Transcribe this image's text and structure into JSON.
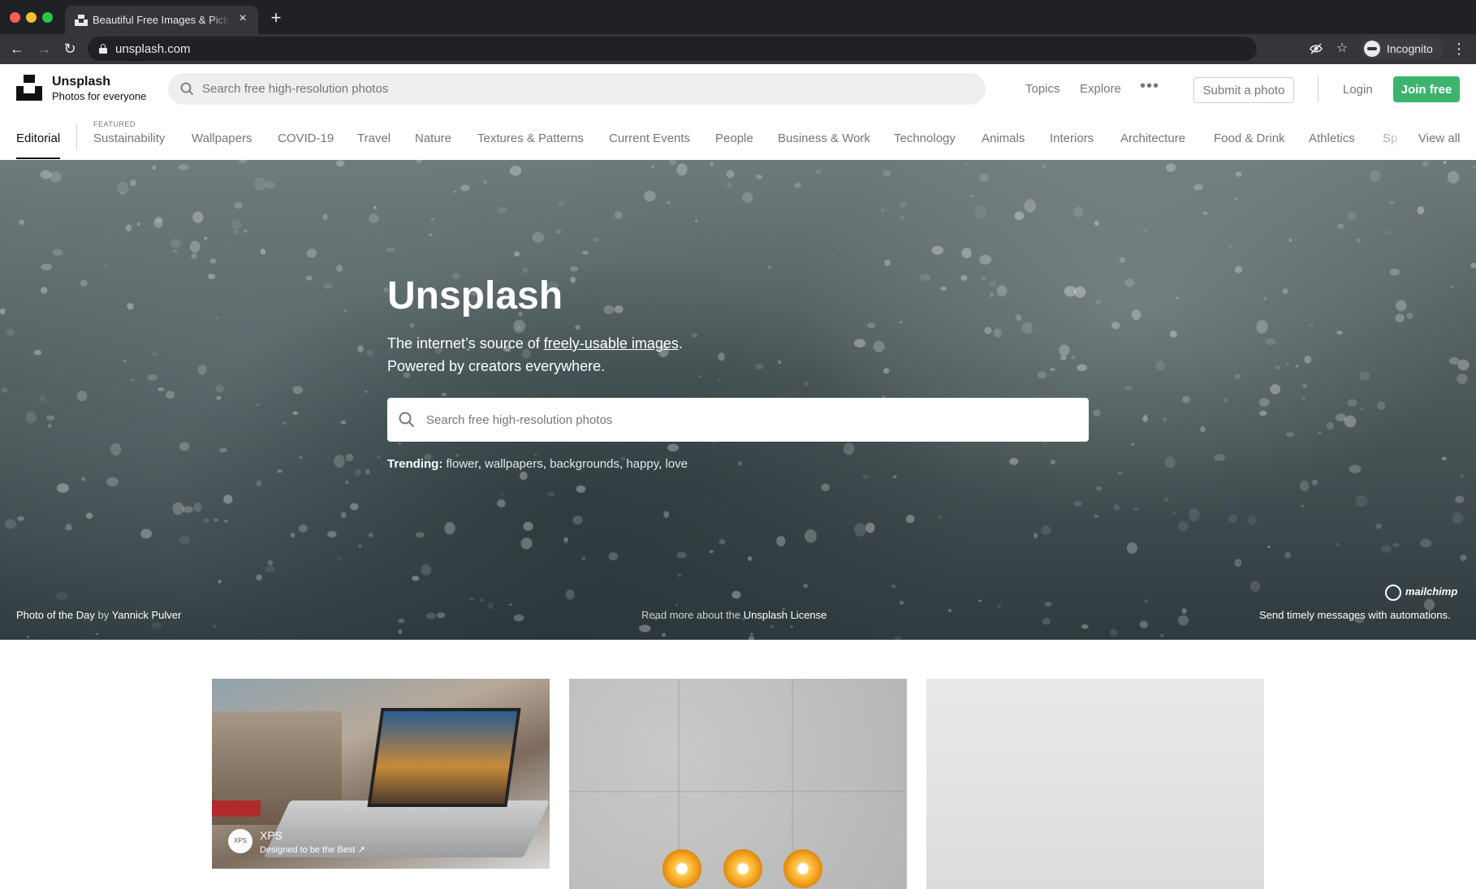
{
  "browser": {
    "tab_title": "Beautiful Free Images & Pictures",
    "tab_close": "×",
    "new_tab": "+",
    "url": "unsplash.com",
    "profile_label": "Incognito",
    "back": "←",
    "forward": "→",
    "reload": "↻",
    "menu": "⋮",
    "icons": [
      "eye-off-icon",
      "star-icon"
    ]
  },
  "header": {
    "brand_name": "Unsplash",
    "brand_tagline": "Photos for everyone",
    "search_placeholder": "Search free high-resolution photos",
    "nav": [
      "Topics",
      "Explore"
    ],
    "more": "•••",
    "submit": "Submit a photo",
    "login": "Login",
    "join": "Join free"
  },
  "topics": {
    "active": "Editorial",
    "featured_label": "FEATURED",
    "items": [
      "Sustainability",
      "Wallpapers",
      "COVID-19",
      "Travel",
      "Nature",
      "Textures & Patterns",
      "Current Events",
      "People",
      "Business & Work",
      "Technology",
      "Animals",
      "Interiors",
      "Architecture",
      "Food & Drink",
      "Athletics",
      "Sp"
    ],
    "view_all": "View all"
  },
  "hero": {
    "title": "Unsplash",
    "line1_prefix": "The internet’s source of ",
    "line1_link": "freely-usable images",
    "line1_suffix": ".",
    "line2": "Powered by creators everywhere.",
    "search_placeholder": "Search free high-resolution photos",
    "trending_label": "Trending:",
    "trending": [
      "flower",
      "wallpapers",
      "backgrounds",
      "happy",
      "love"
    ],
    "photo_prefix": "Photo of the Day",
    "photo_by": "by",
    "photographer": "Yannick Pulver",
    "license_prefix": "Read more about the",
    "license_link": "Unsplash License",
    "sponsor_name": "mailchimp",
    "sponsor_text": "Send timely messages with automations."
  },
  "cards": {
    "ad_brand": "XPS",
    "ad_logo": "XPS",
    "ad_tagline": "Designed to be the Best ↗"
  }
}
